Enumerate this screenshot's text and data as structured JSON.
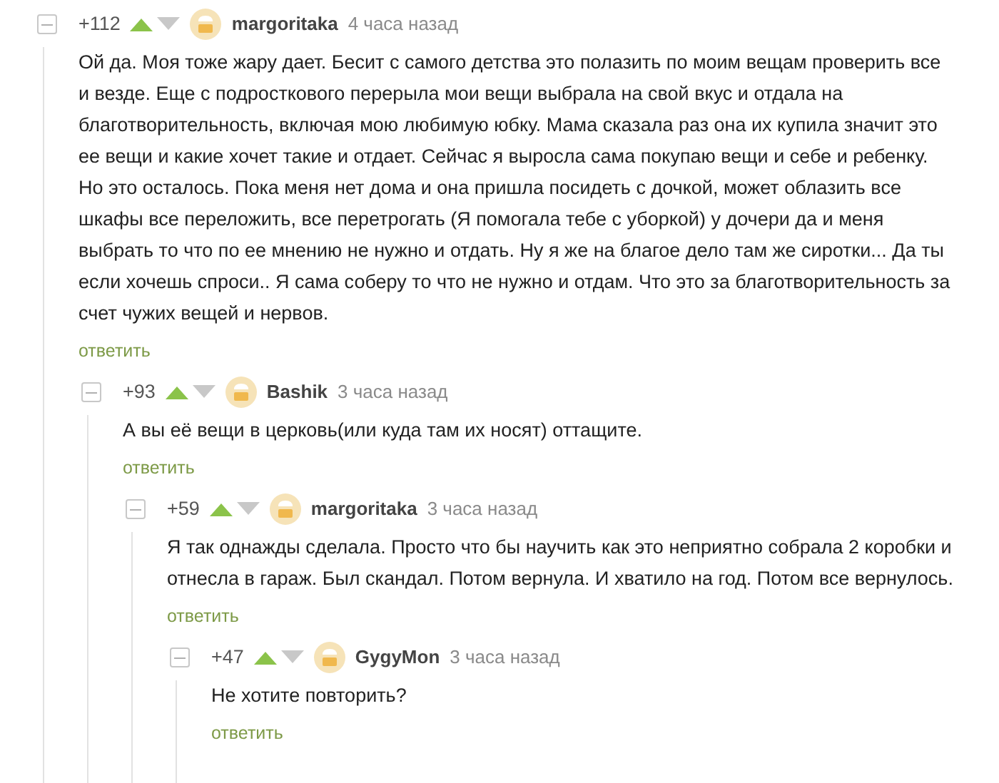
{
  "comments": [
    {
      "score": "+112",
      "author": "margoritaka",
      "time": "4 часа назад",
      "text": "Ой да. Моя тоже жару дает. Бесит с самого детства это полазить по моим вещам проверить все и везде. Еще с подросткового перерыла мои вещи выбрала на свой вкус и отдала на благотворительность, включая мою любимую юбку. Мама сказала раз она их купила значит это ее вещи и какие хочет такие и отдает. Сейчас я выросла сама покупаю вещи и себе и ребенку. Но это осталось. Пока меня нет дома и она пришла посидеть с дочкой, может облазить все шкафы все переложить, все перетрогать (Я помогала тебе с уборкой) у дочери да и меня выбрать то что по ее мнению не нужно и отдать. Ну я же на благое дело там же сиротки... Да ты если хочешь спроси.. Я сама соберу то что не нужно и отдам. Что это за благотворительность за счет чужих вещей и нервов.",
      "reply": "ответить",
      "children": [
        {
          "score": "+93",
          "author": "Bashik",
          "time": "3 часа назад",
          "text": "А вы её вещи в церковь(или куда там их носят) оттащите.",
          "reply": "ответить",
          "children": [
            {
              "score": "+59",
              "author": "margoritaka",
              "time": "3 часа назад",
              "text": "Я так однажды сделала. Просто что бы научить как это неприятно собрала 2 коробки и отнесла в гараж. Был скандал. Потом вернула. И хватило на год. Потом все вернулось.",
              "reply": "ответить",
              "children": [
                {
                  "score": "+47",
                  "author": "GygyMon",
                  "time": "3 часа назад",
                  "text": "Не хотите повторить?",
                  "reply": "ответить"
                }
              ]
            }
          ]
        }
      ]
    }
  ]
}
